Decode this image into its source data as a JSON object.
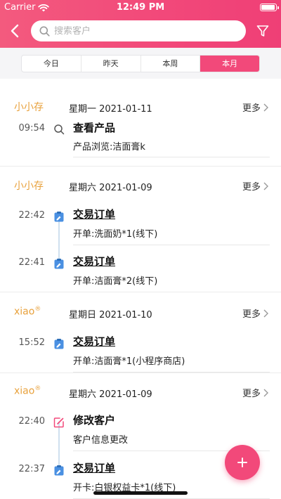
{
  "status": {
    "carrier": "Carrier",
    "time": "12:49 PM",
    "battery_level": 0.85
  },
  "header": {
    "search_placeholder": "搜索客户",
    "icons": {
      "back": "chevron-left-icon",
      "search": "search-icon",
      "filter": "filter-icon"
    }
  },
  "tabs": [
    {
      "label": "今日",
      "active": false
    },
    {
      "label": "昨天",
      "active": false
    },
    {
      "label": "本周",
      "active": false
    },
    {
      "label": "本月",
      "active": true
    }
  ],
  "colors": {
    "accent": "#f2497a",
    "name": "#e8a13c",
    "icon_blue": "#4a90e2"
  },
  "groups": [
    {
      "customer": "小小存",
      "customer_mark": "",
      "date": "星期一 2021-01-11",
      "more": "更多",
      "entries": [
        {
          "time": "09:54",
          "icon": "search-icon",
          "title": "查看产品",
          "desc": "产品浏览:洁面膏k",
          "underline": false
        }
      ]
    },
    {
      "customer": "小小存",
      "customer_mark": "",
      "date": "星期六 2021-01-09",
      "more": "更多",
      "entries": [
        {
          "time": "22:42",
          "icon": "clipboard-icon",
          "title": "交易订单",
          "desc": "开单:洗面奶*1(线下)",
          "underline": true
        },
        {
          "time": "22:41",
          "icon": "clipboard-icon",
          "title": "交易订单",
          "desc": "开单:洁面膏*2(线下)",
          "underline": true
        }
      ]
    },
    {
      "customer": "xiao",
      "customer_mark": "®",
      "date": "星期日 2021-01-10",
      "more": "更多",
      "entries": [
        {
          "time": "15:52",
          "icon": "clipboard-icon",
          "title": "交易订单",
          "desc": "开单:洁面膏*1(小程序商店)",
          "underline": true
        }
      ]
    },
    {
      "customer": "xiao",
      "customer_mark": "®",
      "date": "星期六 2021-01-09",
      "more": "更多",
      "entries": [
        {
          "time": "22:40",
          "icon": "edit-icon",
          "title": "修改客户",
          "desc": "客户信息更改",
          "underline": false
        },
        {
          "time": "22:37",
          "icon": "clipboard-icon",
          "title": "交易订单",
          "desc": "开卡:白银权益卡*1(线下)",
          "underline": true
        }
      ]
    }
  ],
  "fab": {
    "icon": "plus-icon",
    "label": "+"
  }
}
